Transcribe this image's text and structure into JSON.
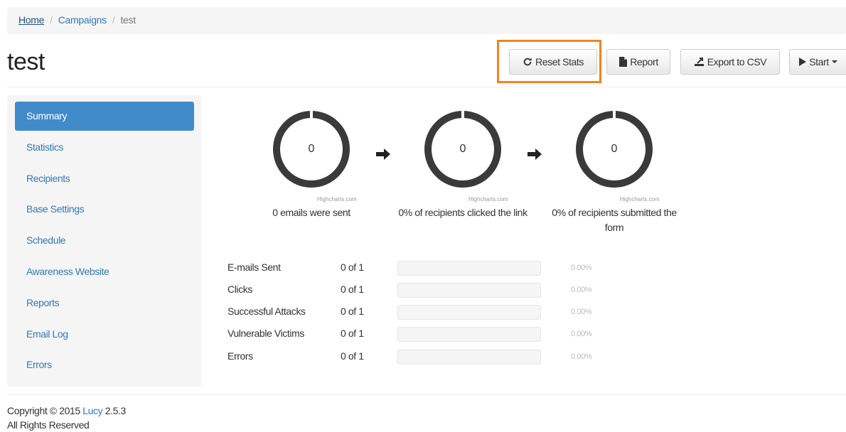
{
  "breadcrumb": {
    "home": "Home",
    "campaigns": "Campaigns",
    "current": "test",
    "separator": "/"
  },
  "page": {
    "title": "test"
  },
  "toolbar": {
    "reset_stats": "Reset Stats",
    "report": "Report",
    "export_csv": "Export to CSV",
    "start": "Start"
  },
  "sidebar": {
    "items": [
      {
        "label": "Summary",
        "active": true
      },
      {
        "label": "Statistics"
      },
      {
        "label": "Recipients"
      },
      {
        "label": "Base Settings"
      },
      {
        "label": "Schedule"
      },
      {
        "label": "Awareness Website"
      },
      {
        "label": "Reports"
      },
      {
        "label": "Email Log"
      },
      {
        "label": "Errors"
      }
    ]
  },
  "funnel": {
    "charts": [
      {
        "value": "0",
        "credit": "Highcharts.com",
        "caption": "0 emails were sent"
      },
      {
        "value": "0",
        "credit": "Highcharts.com",
        "caption": "0% of recipients clicked the link"
      },
      {
        "value": "0",
        "credit": "Highcharts.com",
        "caption": "0% of recipients submitted the form"
      }
    ]
  },
  "stats": {
    "rows": [
      {
        "label": "E-mails Sent",
        "count": "0 of 1",
        "percent": "0.00%",
        "progress": 0
      },
      {
        "label": "Clicks",
        "count": "0 of 1",
        "percent": "0.00%",
        "progress": 0
      },
      {
        "label": "Successful Attacks",
        "count": "0 of 1",
        "percent": "0.00%",
        "progress": 0
      },
      {
        "label": "Vulnerable Victims",
        "count": "0 of 1",
        "percent": "0.00%",
        "progress": 0
      },
      {
        "label": "Errors",
        "count": "0 of 1",
        "percent": "0.00%",
        "progress": 0
      }
    ]
  },
  "footer": {
    "copyright_prefix": "Copyright © 2015 ",
    "brand": "Lucy",
    "version": " 2.5.3",
    "rights": "All Rights Reserved"
  },
  "colors": {
    "accent": "#428bca",
    "link": "#337ab7",
    "highlight": "#f58220",
    "donut": "#3a3a3a"
  }
}
